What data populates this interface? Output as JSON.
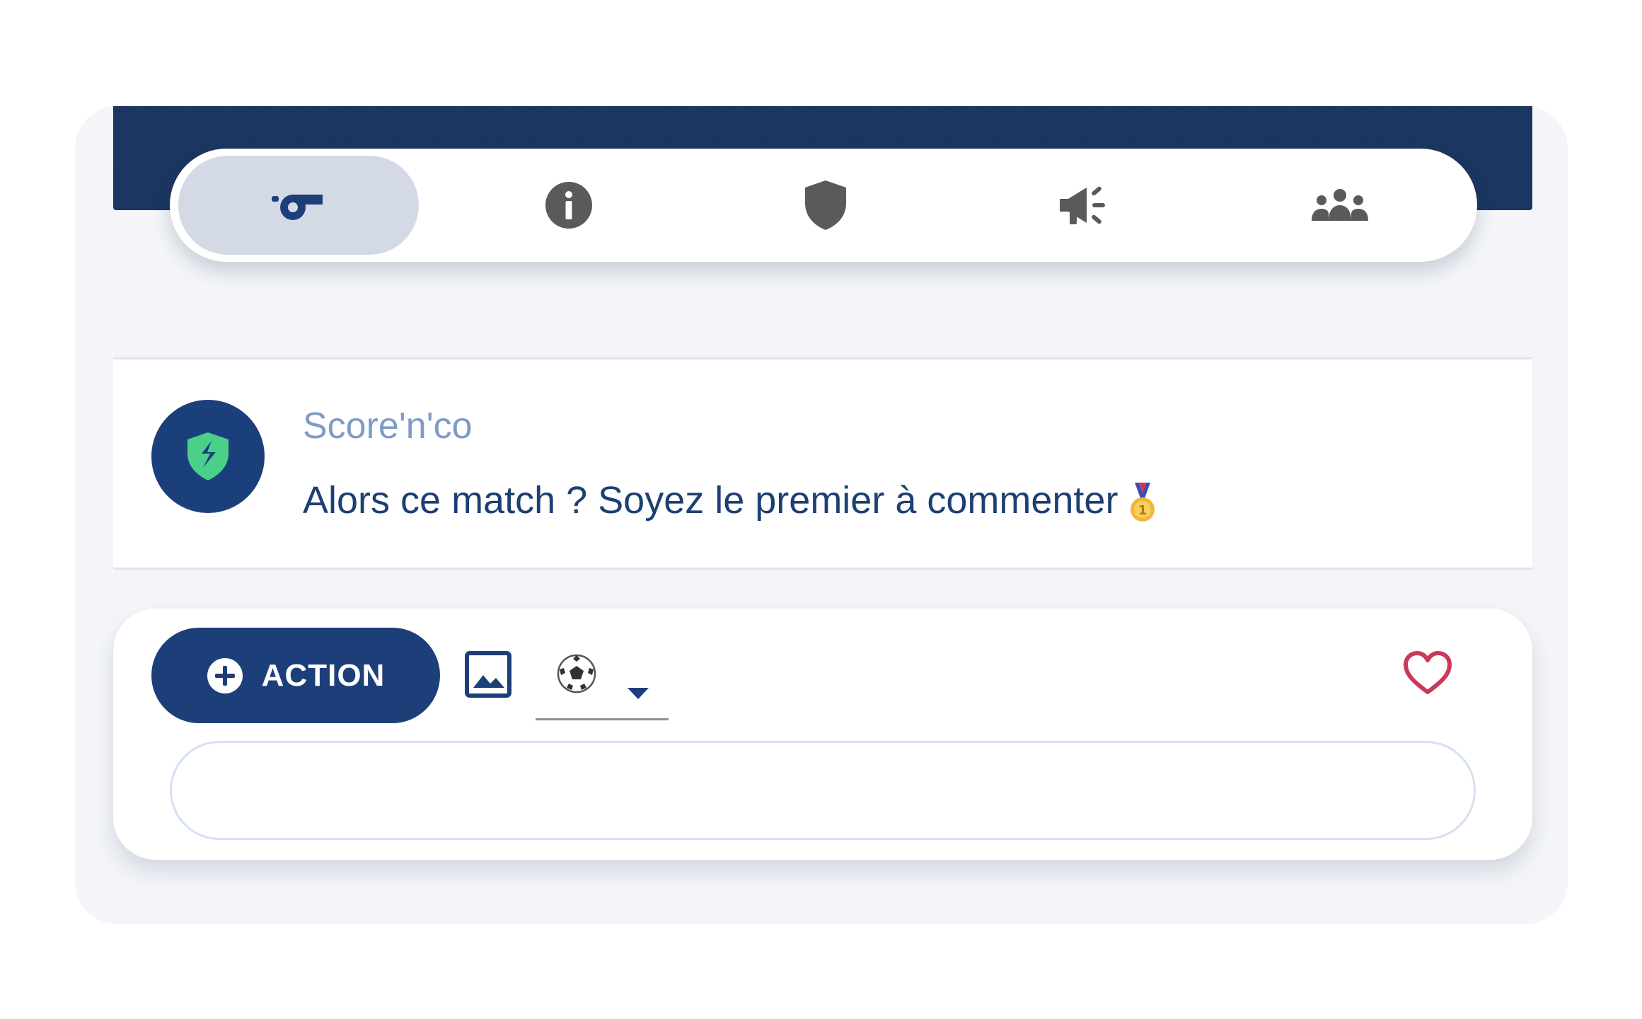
{
  "tabs": [
    {
      "icon": "whistle-icon",
      "active": true
    },
    {
      "icon": "info-icon",
      "active": false
    },
    {
      "icon": "shield-icon",
      "active": false
    },
    {
      "icon": "megaphone-icon",
      "active": false
    },
    {
      "icon": "group-icon",
      "active": false
    }
  ],
  "comment": {
    "author": "Score'n'co",
    "avatar_icon": "scorenco-logo-icon",
    "message": "Alors ce match ? Soyez le premier à commenter",
    "emoji_icon": "first-place-medal-icon"
  },
  "composer": {
    "action_label": "ACTION",
    "action_icon": "plus-circle-icon",
    "image_icon": "image-icon",
    "emoji_selected_icon": "soccer-ball-icon",
    "dropdown_icon": "caret-down-icon",
    "like_icon": "heart-outline-icon",
    "input_value": "",
    "input_placeholder": ""
  },
  "colors": {
    "header_navy": "#1a3560",
    "primary_navy": "#1d3f79",
    "active_tab_bg": "#d3dae6",
    "inactive_icon": "#5a5a5a",
    "author_blue": "#7d9cc6",
    "message_blue": "#1d3f73",
    "heart_red": "#c9395a",
    "logo_green": "#4bd08a"
  }
}
